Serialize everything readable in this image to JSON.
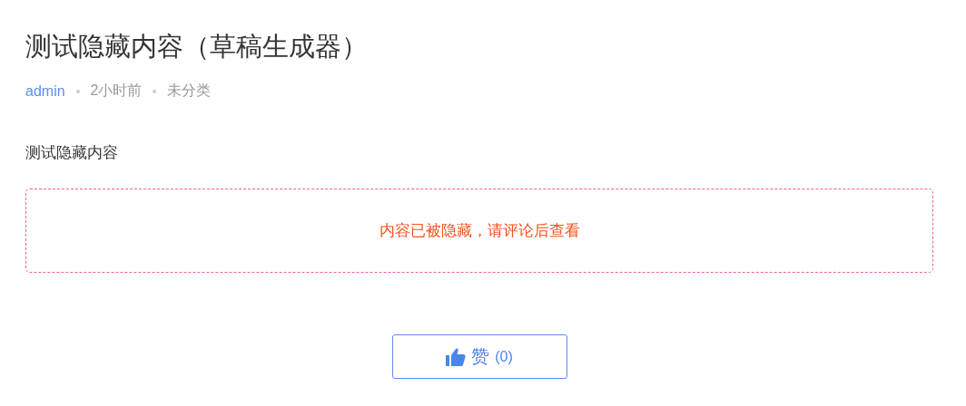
{
  "title": "测试隐藏内容（草稿生成器）",
  "meta": {
    "author": "admin",
    "time": "2小时前",
    "category": "未分类"
  },
  "body": "测试隐藏内容",
  "hidden_notice": "内容已被隐藏，请评论后查看",
  "like_button": {
    "label": "赞",
    "count": "(0)"
  }
}
